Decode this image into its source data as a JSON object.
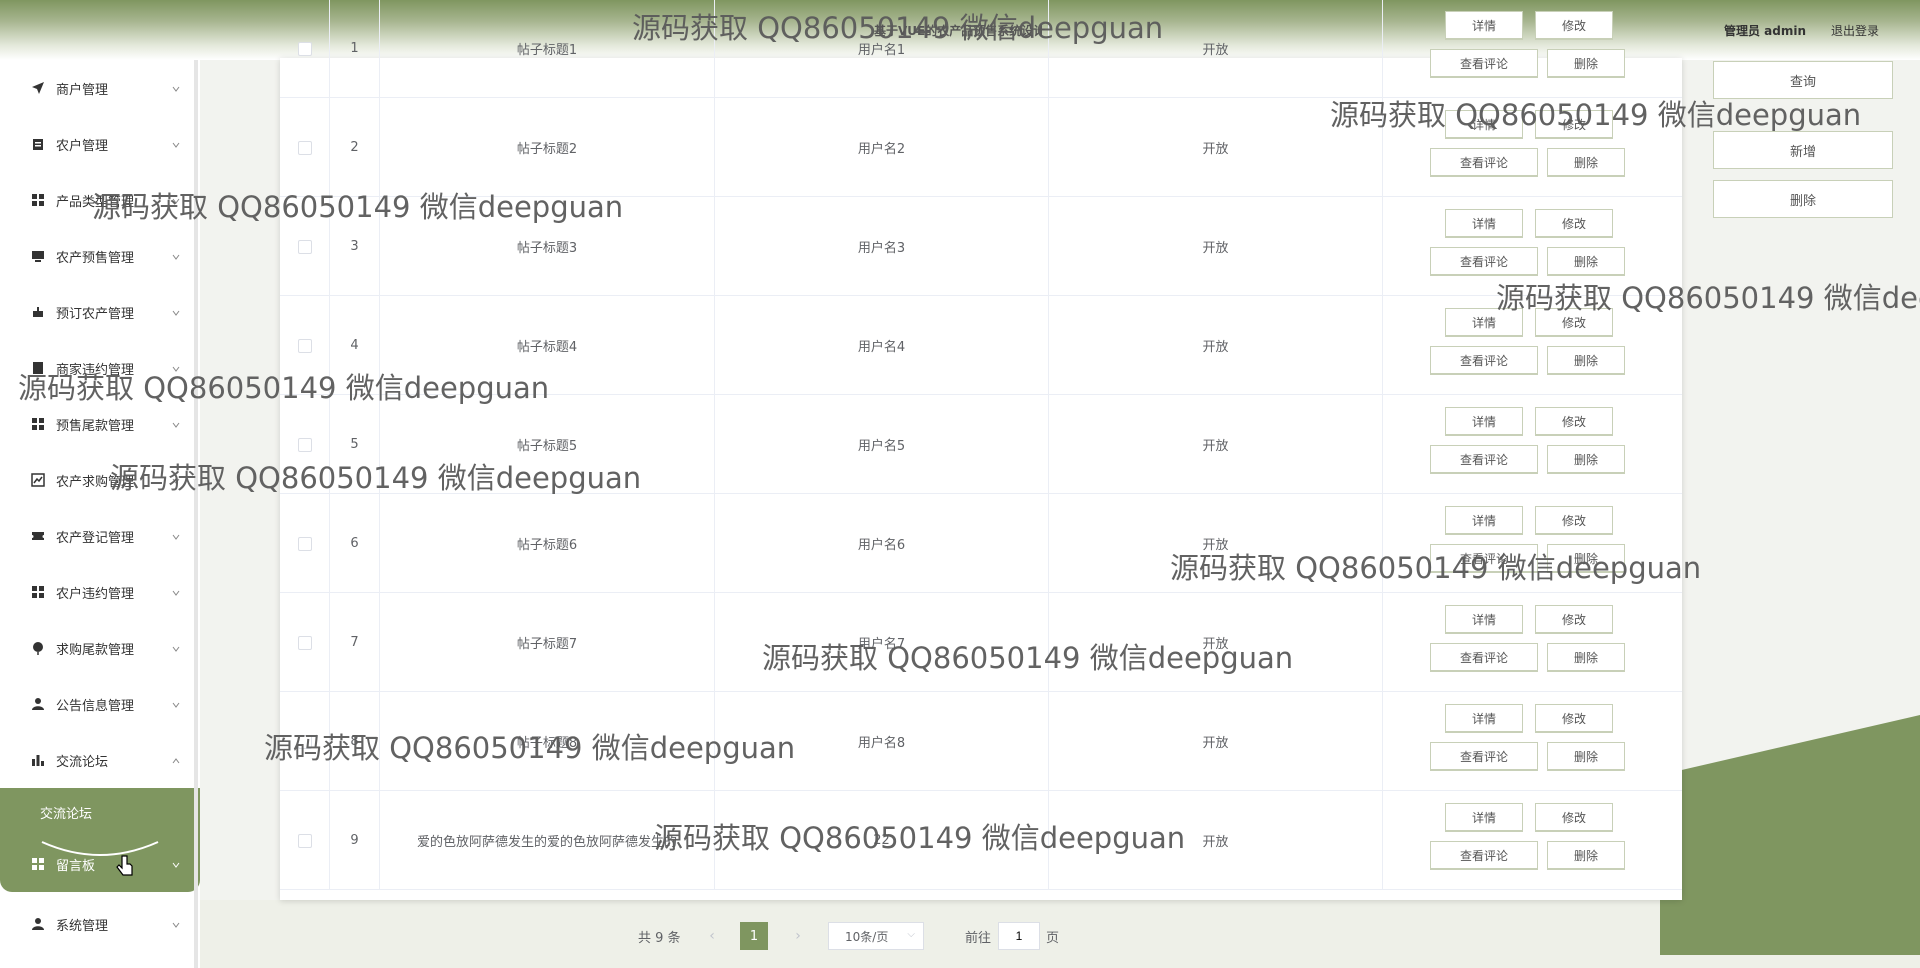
{
  "header": {
    "site_title": "基于VUE的农产品预售系统设计",
    "admin_label": "管理员 admin",
    "logout_label": "退出登录"
  },
  "sidebar": {
    "items": [
      {
        "label": "商户管理",
        "icon": "send-icon"
      },
      {
        "label": "农户管理",
        "icon": "clipboard-icon"
      },
      {
        "label": "产品类型管理",
        "icon": "grid-icon"
      },
      {
        "label": "农产预售管理",
        "icon": "monitor-icon"
      },
      {
        "label": "预订农产管理",
        "icon": "cart-icon"
      },
      {
        "label": "商家违约管理",
        "icon": "doc-icon"
      },
      {
        "label": "预售尾款管理",
        "icon": "grid-icon"
      },
      {
        "label": "农产求购管理",
        "icon": "trend-icon"
      },
      {
        "label": "农产登记管理",
        "icon": "ticket-icon"
      },
      {
        "label": "农户违约管理",
        "icon": "grid-icon"
      },
      {
        "label": "求购尾款管理",
        "icon": "pin-icon"
      },
      {
        "label": "公告信息管理",
        "icon": "user-icon"
      },
      {
        "label": "交流论坛",
        "icon": "bar-icon"
      }
    ],
    "submenu_label": "交流论坛",
    "active_item": {
      "label": "留言板",
      "icon": "grid-icon"
    },
    "last_item": {
      "label": "系统管理",
      "icon": "user-icon"
    }
  },
  "actions": {
    "query": "查询",
    "add": "新增",
    "delete": "删除"
  },
  "row_buttons": {
    "detail": "详情",
    "edit": "修改",
    "comments": "查看评论",
    "delete": "删除"
  },
  "table": {
    "rows": [
      {
        "index": "1",
        "title": "帖子标题1",
        "user": "用户名1",
        "status": "开放"
      },
      {
        "index": "2",
        "title": "帖子标题2",
        "user": "用户名2",
        "status": "开放"
      },
      {
        "index": "3",
        "title": "帖子标题3",
        "user": "用户名3",
        "status": "开放"
      },
      {
        "index": "4",
        "title": "帖子标题4",
        "user": "用户名4",
        "status": "开放"
      },
      {
        "index": "5",
        "title": "帖子标题5",
        "user": "用户名5",
        "status": "开放"
      },
      {
        "index": "6",
        "title": "帖子标题6",
        "user": "用户名6",
        "status": "开放"
      },
      {
        "index": "7",
        "title": "帖子标题7",
        "user": "用户名7",
        "status": "开放"
      },
      {
        "index": "8",
        "title": "帖子标题8",
        "user": "用户名8",
        "status": "开放"
      },
      {
        "index": "9",
        "title": "爱的色放阿萨德发生的爱的色放阿萨德发生的",
        "user": "22",
        "status": "开放"
      }
    ]
  },
  "pagination": {
    "total": "共 9 条",
    "current_page": "1",
    "page_size": "10条/页",
    "goto_prefix": "前往",
    "goto_value": "1",
    "goto_suffix": "页"
  },
  "watermark": "源码获取 QQ86050149 微信deepguan",
  "colors": {
    "accent": "#7f9660",
    "header_top": "#7f9660"
  }
}
